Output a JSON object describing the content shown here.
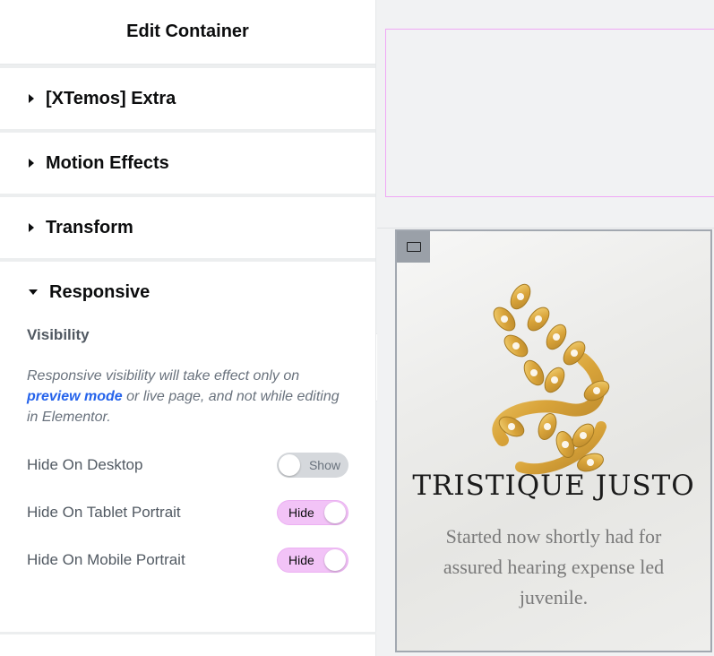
{
  "panel": {
    "title": "Edit Container",
    "sections": [
      {
        "label": "[XTemos] Extra",
        "expanded": false
      },
      {
        "label": "Motion Effects",
        "expanded": false
      },
      {
        "label": "Transform",
        "expanded": false
      },
      {
        "label": "Responsive",
        "expanded": true
      }
    ],
    "responsive": {
      "heading": "Visibility",
      "note_before": "Responsive visibility will take effect only on ",
      "note_link": "preview mode",
      "note_after": " or live page, and not while editing in Elementor.",
      "controls": [
        {
          "label": "Hide On Desktop",
          "state": "Show",
          "on": false
        },
        {
          "label": "Hide On Tablet Portrait",
          "state": "Hide",
          "on": true
        },
        {
          "label": "Hide On Mobile Portrait",
          "state": "Hide",
          "on": true
        }
      ]
    }
  },
  "collapse_icon": "chevron-left-icon",
  "card": {
    "title": "TRISTIQUE JUSTO",
    "description": "Started now shortly had for assured hearing expense led juvenile.",
    "handle_icon": "container-handle-icon"
  },
  "colors": {
    "toggle_on": "#f2c3f7",
    "toggle_off": "#d5d8dc",
    "link": "#2563eb",
    "container_outline": "#f0a8f5",
    "gold": "#e0b24a"
  }
}
